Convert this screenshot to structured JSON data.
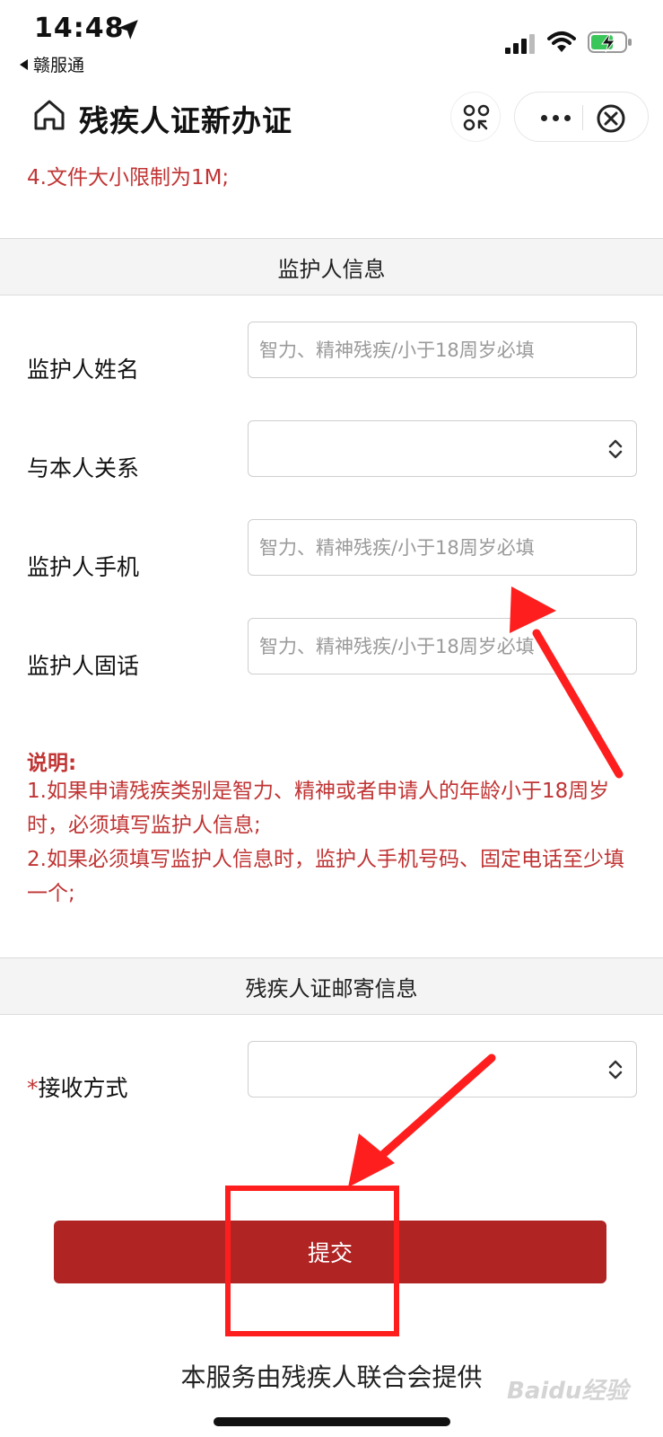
{
  "status_bar": {
    "time": "14:48",
    "back_app": "赣服通",
    "icons": [
      "location-arrow-icon",
      "cellular-signal-icon",
      "wifi-icon",
      "battery-charging-icon"
    ]
  },
  "nav": {
    "title": "残疾人证新办证",
    "icons": [
      "home-icon",
      "scan-icon",
      "more-icon",
      "close-icon"
    ]
  },
  "upload_note": "4.文件大小限制为1M;",
  "guardian_section": {
    "header": "监护人信息",
    "fields": [
      {
        "label": "监护人姓名",
        "placeholder": "智力、精神残疾/小于18周岁必填"
      },
      {
        "label": "与本人关系",
        "placeholder": ""
      },
      {
        "label": "监护人手机",
        "placeholder": "智力、精神残疾/小于18周岁必填"
      },
      {
        "label": "监护人固话",
        "placeholder": "智力、精神残疾/小于18周岁必填"
      }
    ],
    "explanation": {
      "title": "说明:",
      "lines": [
        "1.如果申请残疾类别是智力、精神或者申请人的年龄小于18周岁时，必须填写监护人信息;",
        "2.如果必须填写监护人信息时，监护人手机号码、固定电话至少填一个;"
      ]
    }
  },
  "mailing_section": {
    "header": "残疾人证邮寄信息",
    "required_mark": "*",
    "receive_label": "接收方式"
  },
  "submit_label": "提交",
  "footer": "本服务由残疾人联合会提供",
  "watermark": "Baidu经验",
  "colors": {
    "accent_red": "#b02424",
    "note_red": "#c03434",
    "annotation_red": "#ff1e1e",
    "section_bg": "#f4f4f4"
  }
}
